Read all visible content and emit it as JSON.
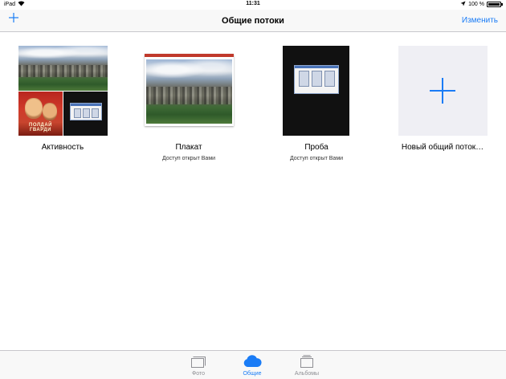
{
  "status_bar": {
    "device": "iPad",
    "time": "11:31",
    "battery": "100 %",
    "battery_level": 1.0
  },
  "nav_bar": {
    "title": "Общие потоки",
    "edit_label": "Изменить",
    "add_icon": "plus-icon"
  },
  "streams": [
    {
      "name": "Активность",
      "subtitle": "",
      "poster_text": "ПОЛДАЙ ГВАРДИ"
    },
    {
      "name": "Плакат",
      "subtitle": "Доступ открыт Вами"
    },
    {
      "name": "Проба",
      "subtitle": "Доступ открыт Вами"
    },
    {
      "name": "Новый общий поток…",
      "subtitle": ""
    }
  ],
  "tab_bar": {
    "tabs": [
      {
        "label": "Фото",
        "icon": "photos-stack-icon",
        "active": false
      },
      {
        "label": "Общие",
        "icon": "cloud-icon",
        "active": true
      },
      {
        "label": "Альбомы",
        "icon": "albums-icon",
        "active": false
      }
    ]
  },
  "colors": {
    "accent": "#1a7cf6",
    "inactive": "#8e8e93",
    "background": "#ffffff",
    "placeholder_tile": "#efeff4"
  }
}
